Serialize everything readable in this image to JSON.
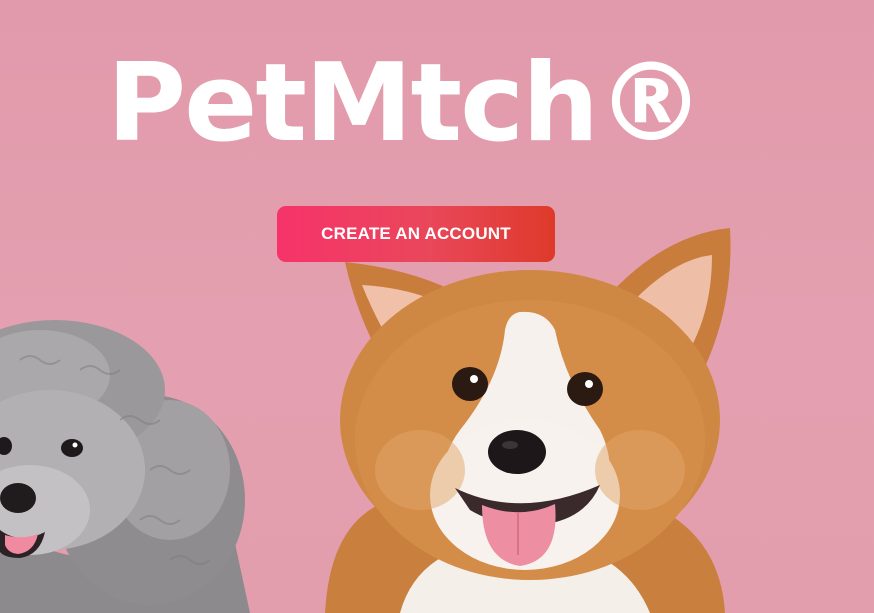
{
  "hero": {
    "brand": "PetMtch®",
    "cta_label": "CREATE AN ACCOUNT",
    "background_color": "#e19aab",
    "cta_gradient": [
      "#f6336a",
      "#de3a2a"
    ]
  },
  "images": [
    {
      "name": "poodle-image",
      "subject": "grey poodle"
    },
    {
      "name": "corgi-image",
      "subject": "corgi"
    }
  ]
}
